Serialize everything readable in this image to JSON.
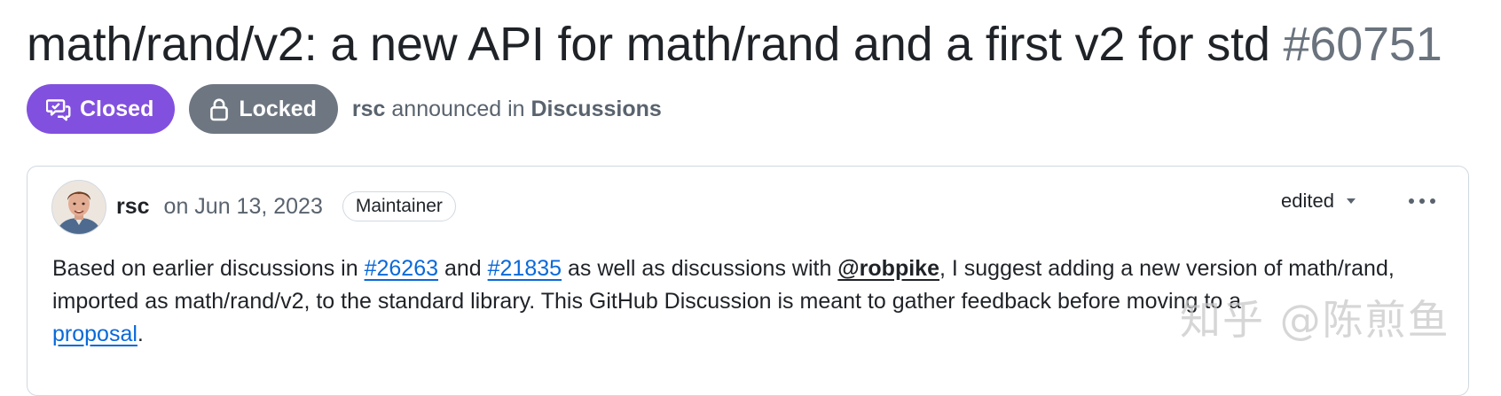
{
  "discussion": {
    "title": "math/rand/v2: a new API for math/rand and a first v2 for std",
    "number": "#60751"
  },
  "status": {
    "closed_label": "Closed",
    "locked_label": "Locked",
    "author": "rsc",
    "announced_text": "announced in",
    "category": "Discussions"
  },
  "post": {
    "author": "rsc",
    "date": "on Jun 13, 2023",
    "role_badge": "Maintainer",
    "edited_label": "edited",
    "body": {
      "t1": "Based on earlier discussions in ",
      "link1": "#26263",
      "t2": " and ",
      "link2": "#21835",
      "t3": " as well as discussions with ",
      "mention": "@robpike",
      "t4": ", I suggest adding a new version of math/rand, imported as math/rand/v2, to the standard library. This GitHub Discussion is meant to gather feedback before moving to a ",
      "link3": "proposal",
      "t5": "."
    }
  },
  "watermark": "知乎 @陈煎鱼",
  "icons": {
    "closed": "discussion-closed-icon",
    "locked": "lock-icon",
    "edited_caret": "triangle-down-icon",
    "menu": "kebab-horizontal-icon"
  },
  "colors": {
    "closed_badge": "#8250df",
    "locked_badge": "#6e7781",
    "link": "#0969da",
    "muted": "#59636e"
  }
}
